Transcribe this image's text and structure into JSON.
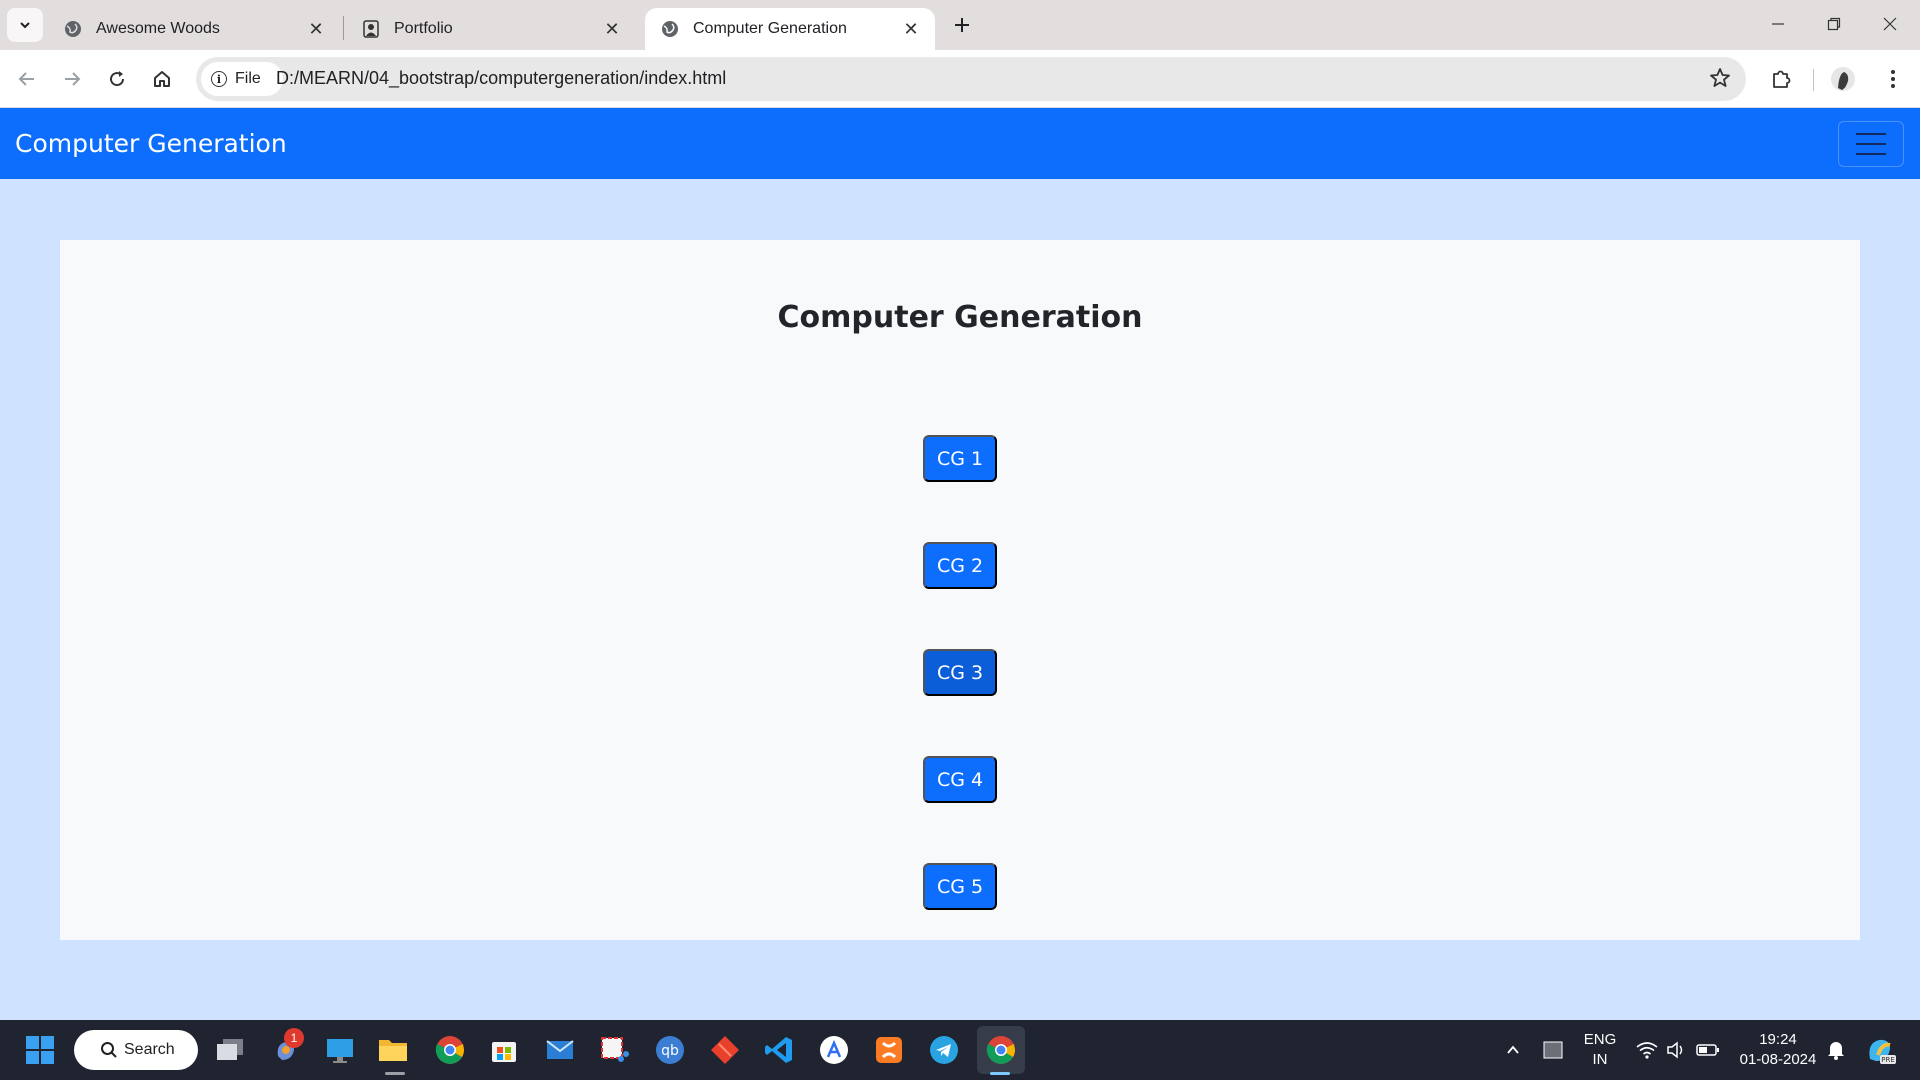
{
  "browser": {
    "tabs": [
      {
        "title": "Awesome Woods",
        "icon": "globe-icon"
      },
      {
        "title": "Portfolio",
        "icon": "user-portfolio-icon"
      },
      {
        "title": "Computer Generation",
        "icon": "globe-icon",
        "active": true
      }
    ],
    "site_chip_label": "File",
    "url": "D:/MEARN/04_bootstrap/computergeneration/index.html"
  },
  "page": {
    "navbar_brand": "Computer Generation",
    "heading": "Computer Generation",
    "buttons": [
      "CG 1",
      "CG 2",
      "CG 3",
      "CG 4",
      "CG 5"
    ],
    "hovered_button": "CG 3",
    "colors": {
      "navbar": "#0d6efd",
      "page_bg": "#cfe2ff",
      "card_bg": "#f8f9fa",
      "button": "#0d6efd",
      "button_hover": "#0b5ed7"
    }
  },
  "taskbar": {
    "search_label": "Search",
    "notification_count": "1",
    "language_line1": "ENG",
    "language_line2": "IN",
    "time": "19:24",
    "date": "01-08-2024",
    "pinned_apps": [
      "task-view-icon",
      "copilot-icon",
      "desktop-icon",
      "file-explorer-icon",
      "chrome-icon",
      "store-icon",
      "mail-icon",
      "snipping-tool-icon",
      "qbittorrent-icon",
      "git-icon",
      "vscode-icon",
      "app-store-icon",
      "xampp-icon",
      "telegram-icon",
      "chrome-active-icon"
    ]
  }
}
